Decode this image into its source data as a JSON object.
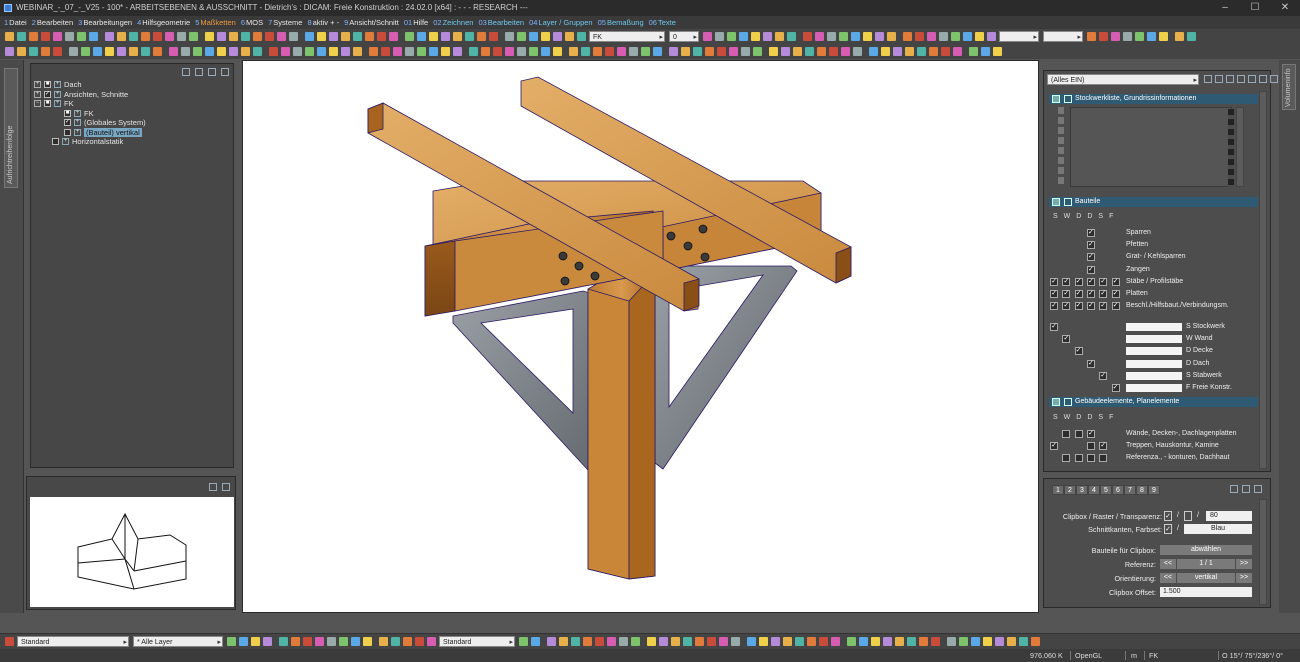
{
  "window": {
    "title": "WEBINAR_-_07_-_V25 - 100* - ARBEITSEBENEN & AUSSCHNITT - Dietrich's : DICAM: Freie Konstruktion : 24.02.0 [x64] : - - - RESEARCH ---",
    "minimize": "–",
    "maximize": "☐",
    "close": "✕"
  },
  "menu": [
    {
      "num": "1",
      "label": "Datei"
    },
    {
      "num": "2",
      "label": "Bearbeiten"
    },
    {
      "num": "3",
      "label": "Bearbeitungen"
    },
    {
      "num": "4",
      "label": "Hilfsgeometrie"
    },
    {
      "num": "5",
      "label": "Maßketten"
    },
    {
      "num": "6",
      "label": "MOS"
    },
    {
      "num": "7",
      "label": "Systeme"
    },
    {
      "num": "8",
      "label": "aktiv + -"
    },
    {
      "num": "9",
      "label": "Ansicht/Schnitt"
    },
    {
      "num": "01",
      "label": "Hilfe"
    },
    {
      "num": "02",
      "label": "Zeichnen"
    },
    {
      "num": "03",
      "label": "Bearbeiten"
    },
    {
      "num": "04",
      "label": "Layer / Gruppen"
    },
    {
      "num": "05",
      "label": "Bemaßung"
    },
    {
      "num": "06",
      "label": "Texte"
    }
  ],
  "toolbar": {
    "combo_fk": "FK",
    "combo_zero": "0"
  },
  "left_strip": {
    "tab_label": "Aufrichtreihenfolge"
  },
  "tree": {
    "items": [
      {
        "label": "Dach"
      },
      {
        "label": "Ansichten, Schnitte"
      },
      {
        "label": "FK"
      },
      {
        "label": "FK"
      },
      {
        "label": "(Globales System)"
      },
      {
        "label": "(Bauteil) vertikal"
      },
      {
        "label": "Horizontalstatik"
      }
    ]
  },
  "right_panel": {
    "filter": "(Alles EIN)",
    "section1": "Stockwerkliste, Grundrissinformationen",
    "section2": "Bauteile",
    "section3": "Gebäudeelemente, Planelemente",
    "columns": [
      "S",
      "W",
      "D",
      "D",
      "S",
      "F"
    ],
    "columns3": [
      "S",
      "W",
      "D",
      "D",
      "S",
      "F"
    ],
    "bauteile": [
      {
        "label": "Sparren"
      },
      {
        "label": "Pfetten"
      },
      {
        "label": "Grat- / Kehlsparren"
      },
      {
        "label": "Zangen"
      },
      {
        "label": "Stäbe / Profilstäbe"
      },
      {
        "label": "Platten"
      },
      {
        "label": "Beschl./Hilfsbaut./Verbindungsm."
      }
    ],
    "levels": [
      {
        "label": "S Stockwerk"
      },
      {
        "label": "W Wand"
      },
      {
        "label": "D Decke"
      },
      {
        "label": "D Dach"
      },
      {
        "label": "S Stabwerk"
      },
      {
        "label": "F Freie Konstr."
      }
    ],
    "gebaeude": [
      {
        "label": "Wände, Decken-, Dachlagenplatten"
      },
      {
        "label": "Treppen, Hauskontur, Kamine"
      },
      {
        "label": "Referenza., - konturen, Dachhaut"
      }
    ]
  },
  "clip": {
    "tabs": [
      "1",
      "2",
      "3",
      "4",
      "5",
      "6",
      "7",
      "8",
      "9"
    ],
    "clipbox_label": "Clipbox / Raster / Transparenz:",
    "clipbox_value": "80",
    "kanten_label": "Schnittkanten, Farbset:",
    "kanten_value": "Blau",
    "bauteile_label": "Bauteile für Clipbox:",
    "bauteile_btn": "abwählen",
    "referenz_label": "Referenz:",
    "referenz_value": "1 / 1",
    "orient_label": "Orientierung:",
    "orient_value": "vertikal",
    "offset_label": "Clipbox Offset:",
    "offset_value": "1.500",
    "prev": "<<",
    "next": ">>",
    "slash": "/"
  },
  "right_strip": {
    "tab_label": "Volumeninfo"
  },
  "bottom": {
    "combo1": "Standard",
    "combo2": "* Alle Layer",
    "combo3": "Standard"
  },
  "status": {
    "coords": "976.060 K",
    "renderer": "OpenGL",
    "unit": "m",
    "system": "FK",
    "view": "O 15°/ 75°/236°/  0°"
  },
  "colors": {
    "wood_top": "#d9a25a",
    "wood_side": "#b06f2a",
    "steel": "#7d8288",
    "section_header": "#2e5b73"
  }
}
